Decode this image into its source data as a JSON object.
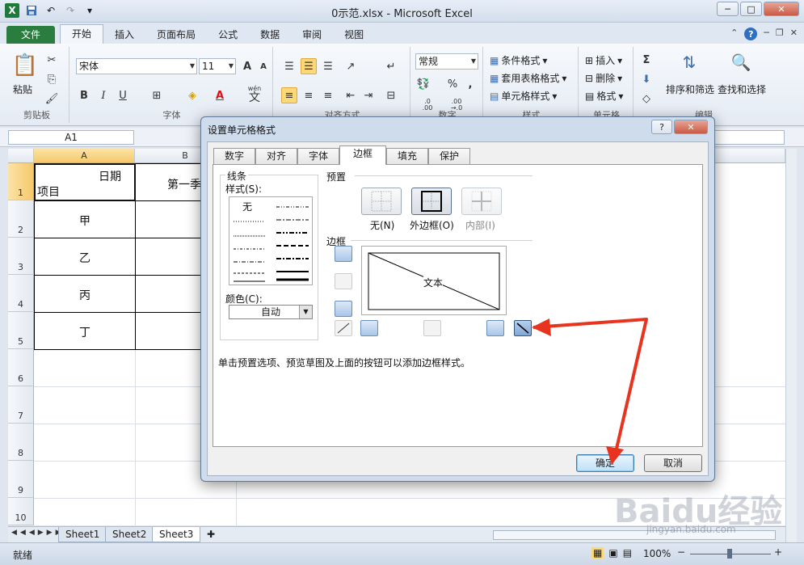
{
  "window": {
    "title": "0示范.xlsx - Microsoft Excel",
    "min": "─",
    "max": "□",
    "close": "✕"
  },
  "ribbon_tabs": [
    "文件",
    "开始",
    "插入",
    "页面布局",
    "公式",
    "数据",
    "审阅",
    "视图"
  ],
  "ribbon": {
    "clipboard": {
      "paste": "粘贴",
      "label": "剪贴板"
    },
    "font": {
      "name": "宋体",
      "size": "11",
      "label": "字体",
      "bold": "B",
      "italic": "I",
      "underline": "U",
      "grow": "A",
      "shrink": "A",
      "color_letter": "A",
      "wen": "wén",
      "wen_char": "文"
    },
    "alignment": {
      "label": "对齐方式"
    },
    "number": {
      "format": "常规",
      "label": "数字",
      "percent": "%",
      "comma": ",",
      "inc1": ".0",
      "inc2": ".00",
      "dec1": ".00",
      "dec2": "→.0"
    },
    "styles": {
      "cond": "条件格式",
      "table": "套用表格格式",
      "cell": "单元格样式",
      "label": "样式"
    },
    "cells": {
      "insert": "插入",
      "delete": "删除",
      "format": "格式",
      "label": "单元格"
    },
    "editing": {
      "sort": "排序和筛选",
      "find": "查找和选择",
      "label": "编辑",
      "sigma": "Σ"
    }
  },
  "formula_bar": {
    "name_box": "A1",
    "fx": "fx"
  },
  "sheet": {
    "columns": [
      "A",
      "B"
    ],
    "rows": [
      "1",
      "2",
      "3",
      "4",
      "5",
      "6",
      "7",
      "8",
      "9",
      "10"
    ],
    "a1_top": "日期",
    "a1_bottom": "项目",
    "b1": "第一季",
    "items": [
      "甲",
      "乙",
      "丙",
      "丁"
    ]
  },
  "sheet_tabs": [
    "Sheet1",
    "Sheet2",
    "Sheet3"
  ],
  "status": {
    "ready": "就绪",
    "zoom": "100%",
    "minus": "−",
    "plus": "+"
  },
  "dialog": {
    "title": "设置单元格格式",
    "help": "?",
    "close": "✕",
    "tabs": [
      "数字",
      "对齐",
      "字体",
      "边框",
      "填充",
      "保护"
    ],
    "line_group": "线条",
    "style_label": "样式(S):",
    "style_none": "无",
    "color_label": "颜色(C):",
    "color_value": "自动",
    "preset_group": "预置",
    "presets": [
      "无(N)",
      "外边框(O)",
      "内部(I)"
    ],
    "border_group": "边框",
    "preview_text": "文本",
    "hint": "单击预置选项、预览草图及上面的按钮可以添加边框样式。",
    "ok": "确定",
    "cancel": "取消"
  },
  "watermark": {
    "text": "Baidu经验",
    "url": "jingyan.baidu.com"
  },
  "colors": {
    "excel_green": "#2a7d3f",
    "arrow_red": "#e8331f",
    "selection": "#f5c96a"
  }
}
